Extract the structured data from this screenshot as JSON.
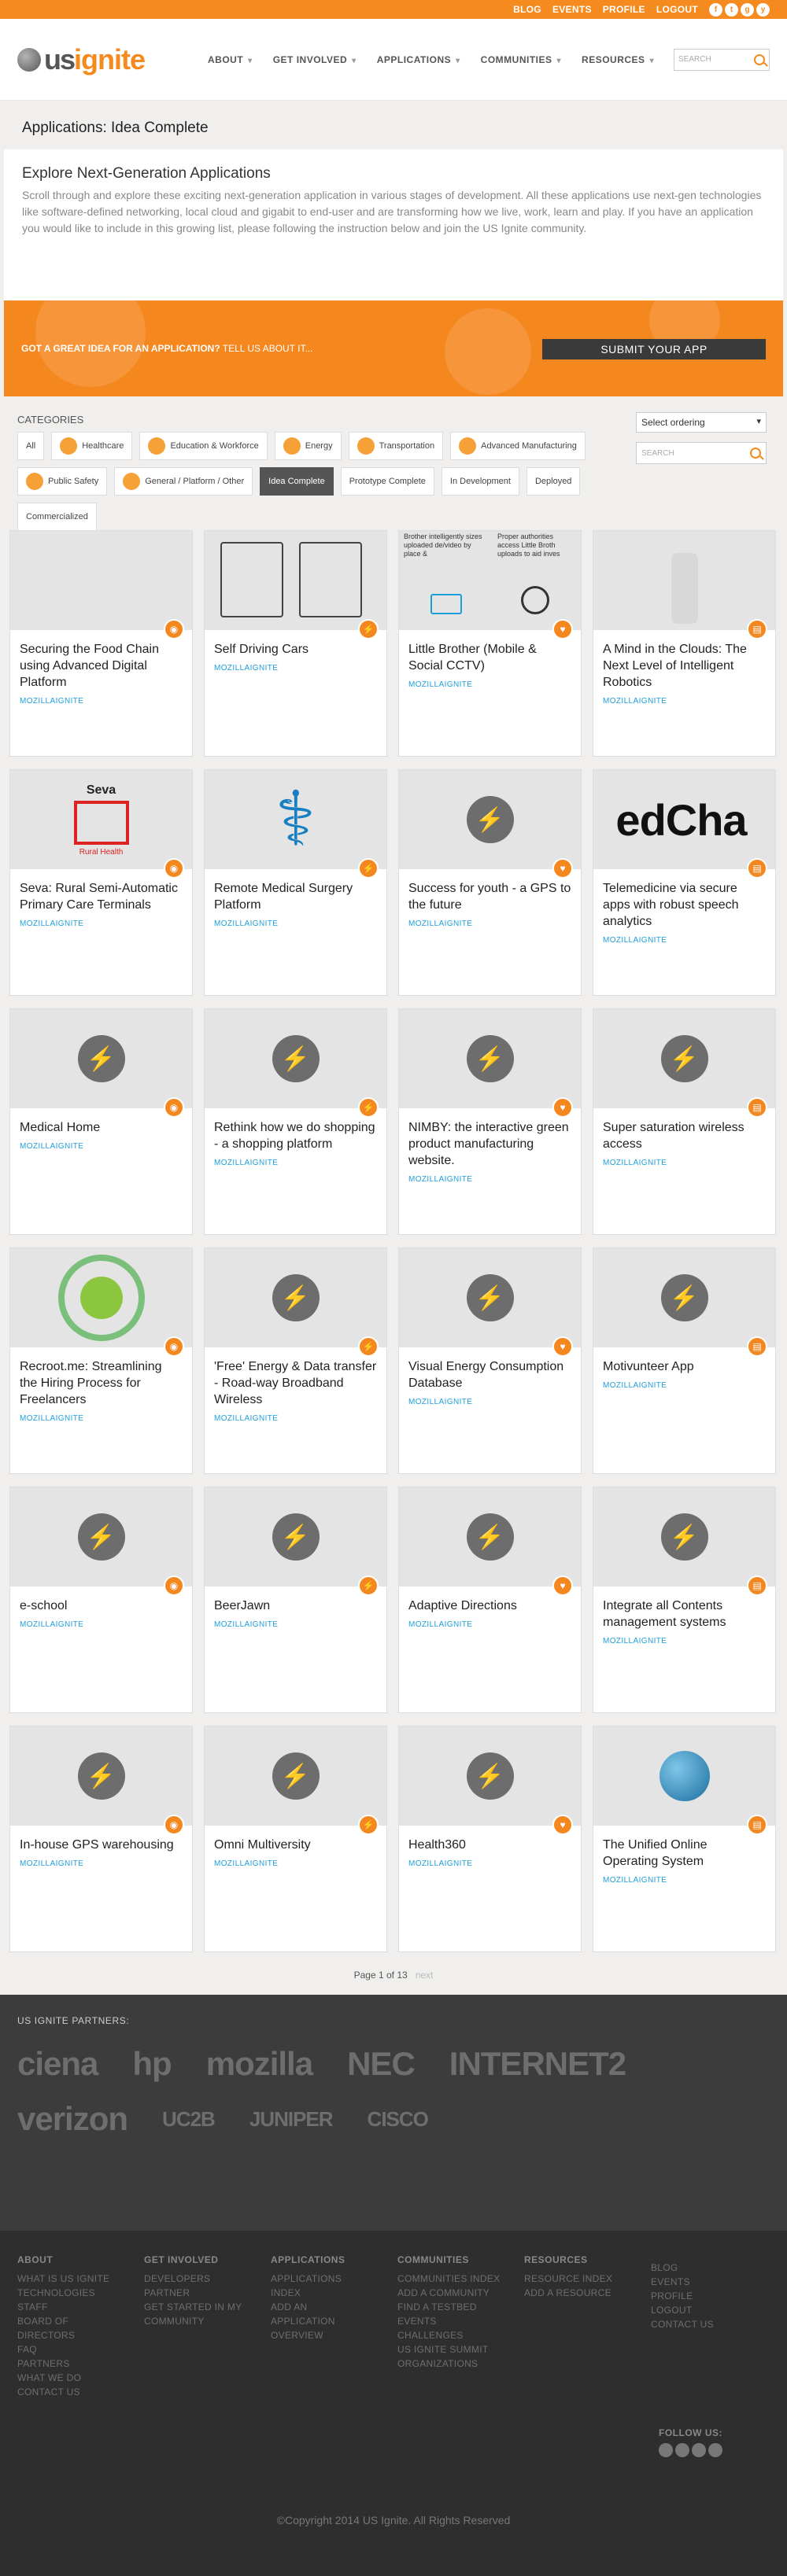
{
  "topbar": {
    "links": [
      "BLOG",
      "EVENTS",
      "PROFILE",
      "LOGOUT"
    ],
    "social": [
      "f",
      "t",
      "g",
      "y"
    ]
  },
  "brand": {
    "us": "us",
    "ignite": "ignite"
  },
  "nav": [
    "ABOUT",
    "GET INVOLVED",
    "APPLICATIONS",
    "COMMUNITIES",
    "RESOURCES"
  ],
  "search": {
    "placeholder": "SEARCH"
  },
  "page_title": "Applications: Idea Complete",
  "intro": {
    "heading": "Explore Next-Generation Applications",
    "body": "Scroll through and explore these exciting next-generation application in various stages of development. All these applications use next-gen technologies like software-defined networking, local cloud and gigabit to end-user and are transforming how we live, work, learn and play. If you have an application you would like to include in this growing list, please following the instruction below and join the US Ignite community."
  },
  "banner": {
    "question": "GOT A GREAT IDEA FOR AN APPLICATION?",
    "tell": " TELL US ABOUT IT...",
    "button": "SUBMIT YOUR APP"
  },
  "categories": {
    "label": "CATEGORIES",
    "tags": [
      {
        "label": "All",
        "icon": false,
        "active": false
      },
      {
        "label": "Healthcare",
        "icon": true,
        "active": false
      },
      {
        "label": "Education & Workforce",
        "icon": true,
        "active": false
      },
      {
        "label": "Energy",
        "icon": true,
        "active": false
      },
      {
        "label": "Transportation",
        "icon": true,
        "active": false
      },
      {
        "label": "Advanced Manufacturing",
        "icon": true,
        "active": false
      },
      {
        "label": "Public Safety",
        "icon": true,
        "active": false
      },
      {
        "label": "General / Platform / Other",
        "icon": true,
        "active": false
      },
      {
        "label": "Idea Complete",
        "icon": false,
        "active": true
      },
      {
        "label": "Prototype Complete",
        "icon": false,
        "active": false
      },
      {
        "label": "In Development",
        "icon": false,
        "active": false
      },
      {
        "label": "Deployed",
        "icon": false,
        "active": false
      },
      {
        "label": "Commercialized",
        "icon": false,
        "active": false
      }
    ],
    "ordering": "Select ordering",
    "search_placeholder": "SEARCH"
  },
  "cards": [
    {
      "title": "Securing the Food Chain using Advanced Digital Platform",
      "author": "MOZILLAIGNITE",
      "img": "garden"
    },
    {
      "title": "Self Driving Cars",
      "author": "MOZILLAIGNITE",
      "img": "door"
    },
    {
      "title": "Little Brother (Mobile & Social CCTV)",
      "author": "MOZILLAIGNITE",
      "img": "cctv"
    },
    {
      "title": "A Mind in the Clouds: The Next Level of Intelligent Robotics",
      "author": "MOZILLAIGNITE",
      "img": "robot"
    },
    {
      "title": "Seva: Rural Semi-Automatic Primary Care Terminals",
      "author": "MOZILLAIGNITE",
      "img": "seva"
    },
    {
      "title": "Remote Medical Surgery Platform",
      "author": "MOZILLAIGNITE",
      "img": "med"
    },
    {
      "title": "Success for youth - a GPS to the future",
      "author": "MOZILLAIGNITE",
      "img": "bolt"
    },
    {
      "title": "Telemedicine via secure apps with robust speech analytics",
      "author": "MOZILLAIGNITE",
      "img": "medcha"
    },
    {
      "title": "Medical Home",
      "author": "MOZILLAIGNITE",
      "img": "bolt"
    },
    {
      "title": "Rethink how we do shopping - a shopping platform",
      "author": "MOZILLAIGNITE",
      "img": "bolt"
    },
    {
      "title": "NIMBY: the interactive green product manufacturing website.",
      "author": "MOZILLAIGNITE",
      "img": "bolt"
    },
    {
      "title": "Super saturation wireless access",
      "author": "MOZILLAIGNITE",
      "img": "bolt"
    },
    {
      "title": "Recroot.me: Streamlining the Hiring Process for Freelancers",
      "author": "MOZILLAIGNITE",
      "img": "recroot"
    },
    {
      "title": "'Free' Energy & Data transfer - Road-way Broadband Wireless",
      "author": "MOZILLAIGNITE",
      "img": "bolt"
    },
    {
      "title": "Visual Energy Consumption Database",
      "author": "MOZILLAIGNITE",
      "img": "bolt"
    },
    {
      "title": "Motivunteer App",
      "author": "MOZILLAIGNITE",
      "img": "bolt"
    },
    {
      "title": "e-school",
      "author": "MOZILLAIGNITE",
      "img": "bolt"
    },
    {
      "title": "BeerJawn",
      "author": "MOZILLAIGNITE",
      "img": "bolt"
    },
    {
      "title": "Adaptive Directions",
      "author": "MOZILLAIGNITE",
      "img": "bolt"
    },
    {
      "title": "Integrate all Contents management systems",
      "author": "MOZILLAIGNITE",
      "img": "bolt"
    },
    {
      "title": "In-house GPS warehousing",
      "author": "MOZILLAIGNITE",
      "img": "bolt"
    },
    {
      "title": "Omni Multiversity",
      "author": "MOZILLAIGNITE",
      "img": "bolt"
    },
    {
      "title": "Health360",
      "author": "MOZILLAIGNITE",
      "img": "bolt"
    },
    {
      "title": "The Unified Online Operating System",
      "author": "MOZILLAIGNITE",
      "img": "net"
    }
  ],
  "seva_text": {
    "name": "Seva",
    "sub": "Rural Health"
  },
  "medcha_text": "edCha",
  "cctv_text": {
    "a": "Brother intelligently sizes uploaded de/video by place &",
    "b": "Proper authorities access Little Broth uploads to aid inves"
  },
  "pager": {
    "label": "Page 1 of 13",
    "next": "next"
  },
  "partners": {
    "label": "US IGNITE PARTNERS:",
    "logos": [
      "ciena",
      "hp",
      "mozilla",
      "NEC",
      "INTERNET2",
      "verizon",
      "UC2B",
      "JUNIPER",
      "CISCO"
    ]
  },
  "footer": {
    "columns": [
      {
        "head": "ABOUT",
        "items": [
          "WHAT IS US IGNITE",
          "TECHNOLOGIES",
          "STAFF",
          "BOARD OF DIRECTORS",
          "FAQ",
          "PARTNERS",
          "WHAT WE DO",
          "CONTACT US"
        ]
      },
      {
        "head": "GET INVOLVED",
        "items": [
          "DEVELOPERS",
          "PARTNER",
          "GET STARTED IN MY COMMUNITY"
        ]
      },
      {
        "head": "APPLICATIONS",
        "items": [
          "APPLICATIONS INDEX",
          "ADD AN APPLICATION",
          "OVERVIEW"
        ]
      },
      {
        "head": "COMMUNITIES",
        "items": [
          "COMMUNITIES INDEX",
          "ADD A COMMUNITY",
          "FIND A TESTBED",
          "EVENTS",
          "CHALLENGES",
          "US IGNITE SUMMIT",
          "ORGANIZATIONS"
        ]
      },
      {
        "head": "RESOURCES",
        "items": [
          "RESOURCE INDEX",
          "ADD A RESOURCE"
        ]
      },
      {
        "head": "",
        "items": [
          "BLOG",
          "EVENTS",
          "PROFILE",
          "LOGOUT",
          "CONTACT US"
        ]
      }
    ],
    "follow": "FOLLOW US:",
    "copyright": "©Copyright 2014 US Ignite. All Rights Reserved"
  },
  "colors": {
    "accent": "#f58a1f",
    "link": "#1e9ed8",
    "dark": "#3a3a3a"
  }
}
